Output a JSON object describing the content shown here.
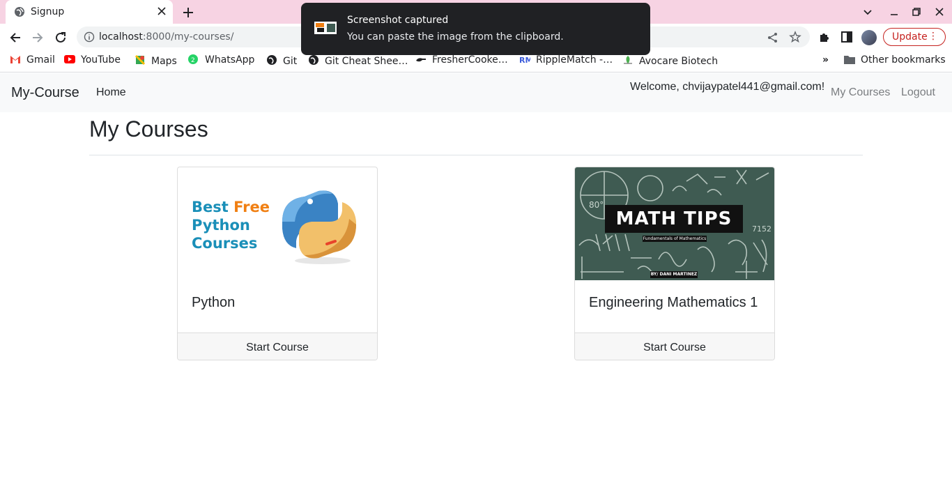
{
  "browser": {
    "tab_title": "Signup",
    "url_host": "localhost",
    "url_rest": ":8000/my-courses/",
    "update_label": "Update",
    "bookmarks": [
      {
        "label": "Gmail",
        "icon": "gmail-icon",
        "color": "#ea4335"
      },
      {
        "label": "YouTube",
        "icon": "youtube-icon",
        "color": "#ff0000"
      },
      {
        "label": "Maps",
        "icon": "maps-icon",
        "color": "#34a853"
      },
      {
        "label": "WhatsApp",
        "icon": "whatsapp-icon",
        "color": "#25d366"
      },
      {
        "label": "Git",
        "icon": "globe-icon",
        "color": "#202124"
      },
      {
        "label": "Git Cheat Shee…",
        "icon": "globe-icon",
        "color": "#202124"
      },
      {
        "label": "FresherCooke…",
        "icon": "freshercooker-icon",
        "color": "#202124"
      },
      {
        "label": "RippleMatch -…",
        "icon": "ripplematch-icon",
        "color": "#3b5bdb"
      },
      {
        "label": "Avocare Biotech",
        "icon": "avocare-icon",
        "color": "#4caf50"
      }
    ],
    "more_bookmarks": "»",
    "other_bookmarks": "Other bookmarks"
  },
  "toast": {
    "title": "Screenshot captured",
    "message": "You can paste the image from the clipboard."
  },
  "navbar": {
    "brand": "My-Course",
    "home": "Home",
    "welcome": "Welcome, chvijaypatel441@gmail.com!",
    "my_courses": "My Courses",
    "logout": "Logout"
  },
  "page": {
    "title": "My Courses"
  },
  "courses": [
    {
      "title": "Python",
      "button": "Start Course",
      "image": {
        "line1_a": "Best ",
        "line1_b": "Free",
        "line2": "Python",
        "line3": "Courses"
      }
    },
    {
      "title": "Engineering Mathematics 1",
      "button": "Start Course",
      "image": {
        "banner": "MATH TIPS",
        "subtitle": "Fundamentals of Mathematics",
        "byline": "BY/ DANI MARTINEZ"
      }
    }
  ],
  "colors": {
    "tabbar": "#f7d3e3",
    "navbar": "#f8f9fa",
    "update_red": "#c5221f",
    "python_blue": "#1a8fb8",
    "python_orange": "#f07f12",
    "chalkboard": "#3f5b52"
  }
}
